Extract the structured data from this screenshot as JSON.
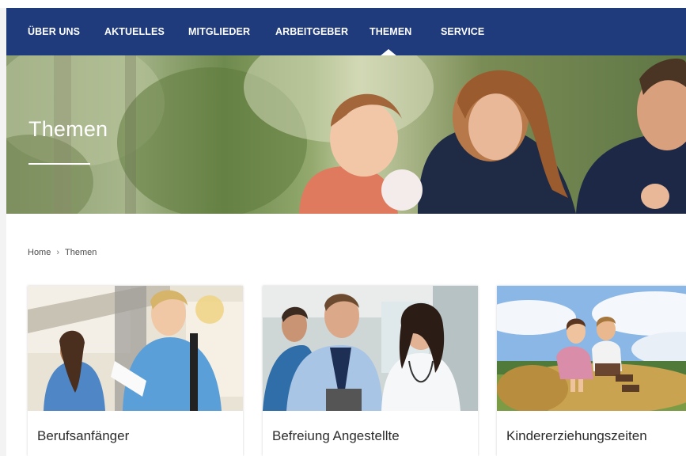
{
  "nav": {
    "items": [
      {
        "label": "ÜBER UNS"
      },
      {
        "label": "AKTUELLES"
      },
      {
        "label": "MITGLIEDER"
      },
      {
        "label": "ARBEITGEBER"
      },
      {
        "label": "THEMEN"
      },
      {
        "label": "SERVICE"
      }
    ],
    "active": "THEMEN",
    "background": "#1f3b7c"
  },
  "hero": {
    "title": "Themen"
  },
  "breadcrumb": {
    "home": "Home",
    "separator": "›",
    "current": "Themen"
  },
  "cards": [
    {
      "title": "Berufsanfänger"
    },
    {
      "title": "Befreiung Angestellte"
    },
    {
      "title": "Kindererziehungszeiten"
    }
  ]
}
